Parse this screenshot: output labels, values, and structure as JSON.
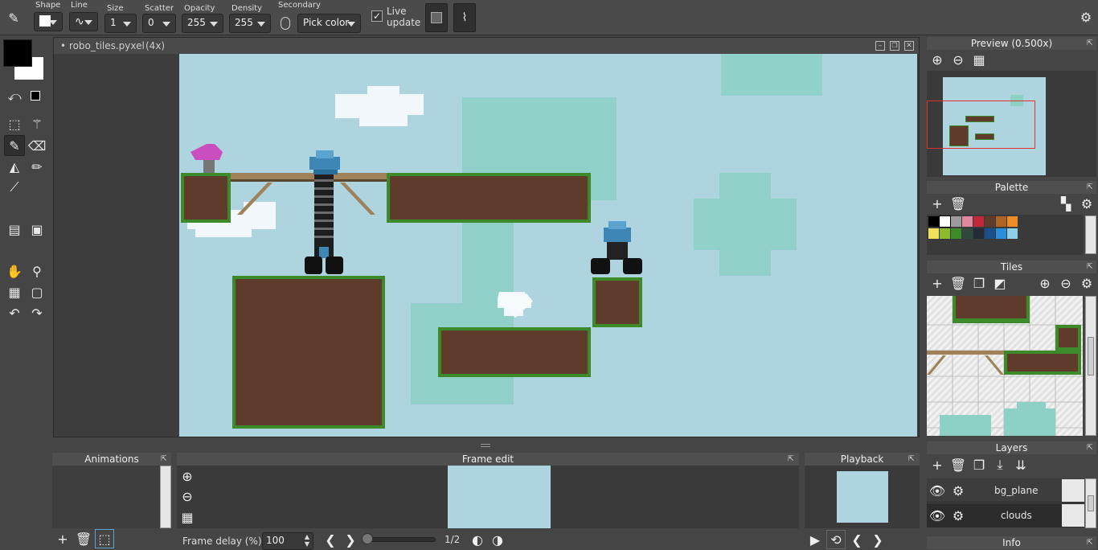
{
  "toolbar": {
    "shape_label": "Shape",
    "line_label": "Line",
    "size_label": "Size",
    "size_value": "1",
    "scatter_label": "Scatter",
    "scatter_value": "0",
    "opacity_label": "Opacity",
    "opacity_value": "255",
    "density_label": "Density",
    "density_value": "255",
    "secondary_label": "Secondary",
    "secondary_value": "Pick color",
    "live_update_label_1": "Live",
    "live_update_label_2": "update"
  },
  "document": {
    "title": "• robo_tiles.pyxel",
    "zoom": "(4x)"
  },
  "panels": {
    "preview_title": "Preview (0.500x)",
    "palette_title": "Palette",
    "tiles_title": "Tiles",
    "layers_title": "Layers",
    "info_title": "Info",
    "animations_title": "Animations",
    "frame_edit_title": "Frame edit",
    "playback_title": "Playback"
  },
  "layers": [
    {
      "name": "bg_plane"
    },
    {
      "name": "clouds"
    }
  ],
  "frame": {
    "delay_label": "Frame delay (%)",
    "delay_value": "100",
    "counter": "1/2"
  },
  "colors": {
    "primary": "#000000",
    "secondary": "#ffffff",
    "sky": "#add4df",
    "dirt": "#5e3b2b",
    "grass": "#3c8a2a",
    "water": "#8dd0c6"
  },
  "palette": [
    "#000000",
    "#ffffff",
    "#9b9b9b",
    "#e0889c",
    "#c2283c",
    "#5e3b2b",
    "#b06220",
    "#f08c28",
    "#f2e25a",
    "#8bbb2c",
    "#3c8a2a",
    "#2f4a3c",
    "#242a36",
    "#1a4f8a",
    "#2a8fd8",
    "#8dcfe6"
  ]
}
